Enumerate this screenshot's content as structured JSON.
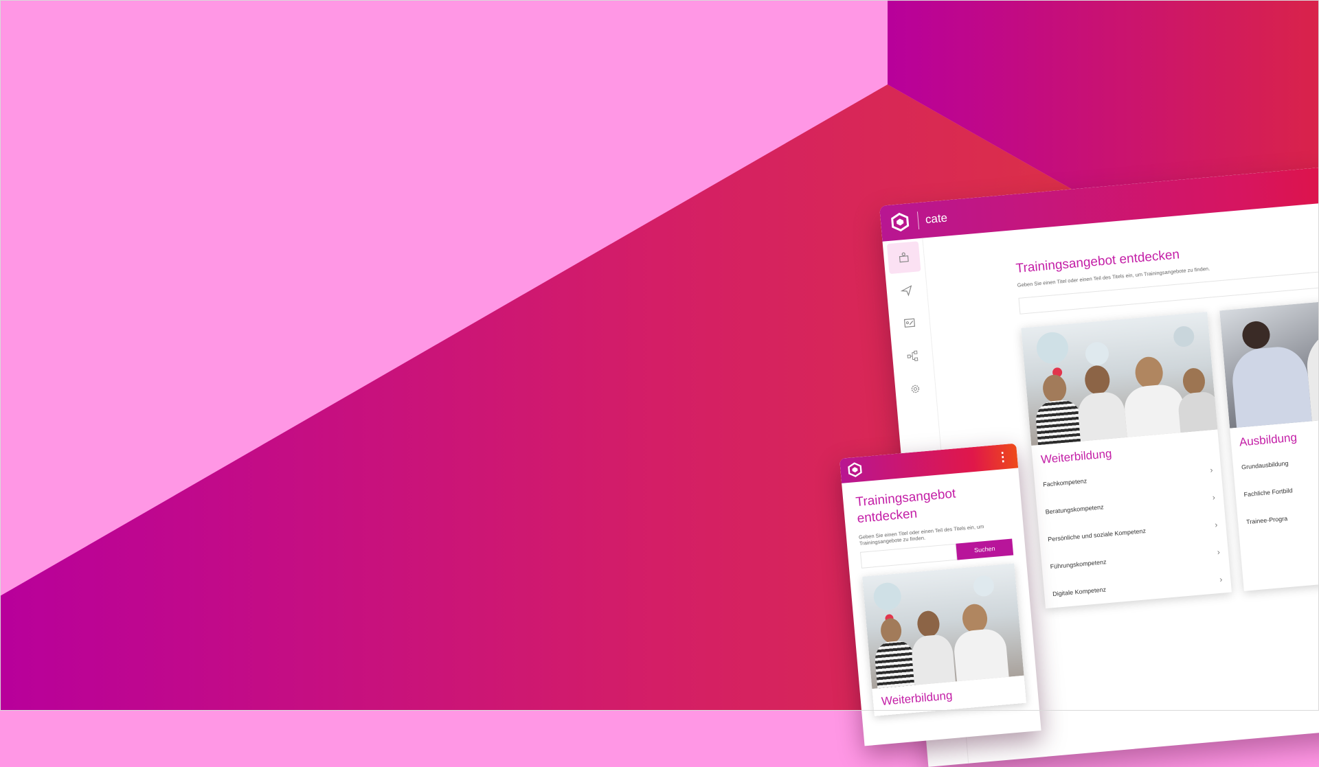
{
  "colors": {
    "pink_bg": "#ff97e5",
    "magenta": "#b8009b",
    "red": "#e0283a",
    "accent": "#c31ea6"
  },
  "desktop": {
    "app_name": "cate",
    "title": "Trainingsangebot entdecken",
    "subtitle": "Geben Sie einen Titel oder einen Teil des Titels ein, um Trainingsangebote zu finden.",
    "nav_icons": [
      "training-icon",
      "send-icon",
      "presentation-icon",
      "hierarchy-icon",
      "settings-icon"
    ],
    "cards": [
      {
        "title": "Weiterbildung",
        "items": [
          "Fachkompetenz",
          "Beratungskompetenz",
          "Persönliche und soziale Kompetenz",
          "Führungskompetenz",
          "Digitale Kompetenz"
        ]
      },
      {
        "title": "Ausbildung",
        "items": [
          "Grundausbildung",
          "Fachliche Fortbild",
          "Trainee-Progra"
        ]
      }
    ]
  },
  "mobile": {
    "title": "Trainingsangebot entdecken",
    "subtitle": "Geben Sie einen Titel oder einen Teil des Titels ein, um Trainingsangebote zu finden.",
    "search_button": "Suchen",
    "menu_glyph": "⋮",
    "card_title": "Weiterbildung"
  }
}
